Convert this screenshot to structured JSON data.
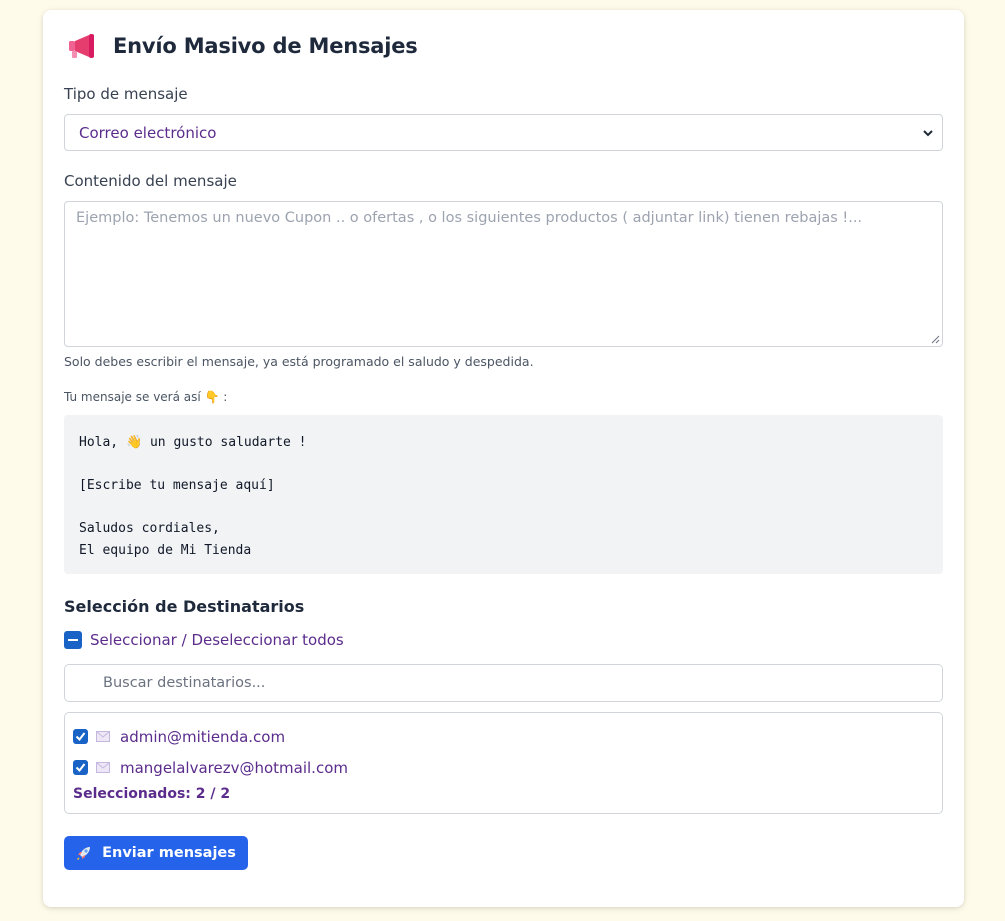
{
  "header": {
    "icon": "megaphone-icon",
    "title": "Envío Masivo de Mensajes"
  },
  "message_type": {
    "label": "Tipo de mensaje",
    "selected": "Correo electrónico"
  },
  "content": {
    "label": "Contenido del mensaje",
    "placeholder": "Ejemplo: Tenemos un nuevo Cupon .. o ofertas , o los siguientes productos ( adjuntar link) tienen rebajas !...",
    "hint": "Solo debes escribir el mensaje, ya está programado el saludo y despedida."
  },
  "preview": {
    "label": "Tu mensaje se verá así 👇 :",
    "greeting": "Hola,  👋 un gusto saludarte !",
    "body": "[Escribe tu mensaje aquí]",
    "closing_1": "Saludos cordiales,",
    "closing_2": "El equipo de Mi Tienda"
  },
  "recipients": {
    "title": "Selección de Destinatarios",
    "toggle_all_label": "Seleccionar / Deseleccionar todos",
    "search_placeholder": "Buscar destinatarios...",
    "items": [
      {
        "email": "admin@mitienda.com",
        "checked": true
      },
      {
        "email": "mangelalvarezv@hotmail.com",
        "checked": true
      }
    ],
    "count_label": "Seleccionados: 2 / 2"
  },
  "send_button": {
    "icon": "rocket-icon",
    "label": "Enviar mensajes"
  },
  "colors": {
    "page_bg": "#fffbea",
    "accent": "#2563eb",
    "checkbox": "#1a63c6",
    "link_text": "#5b2c8c"
  }
}
